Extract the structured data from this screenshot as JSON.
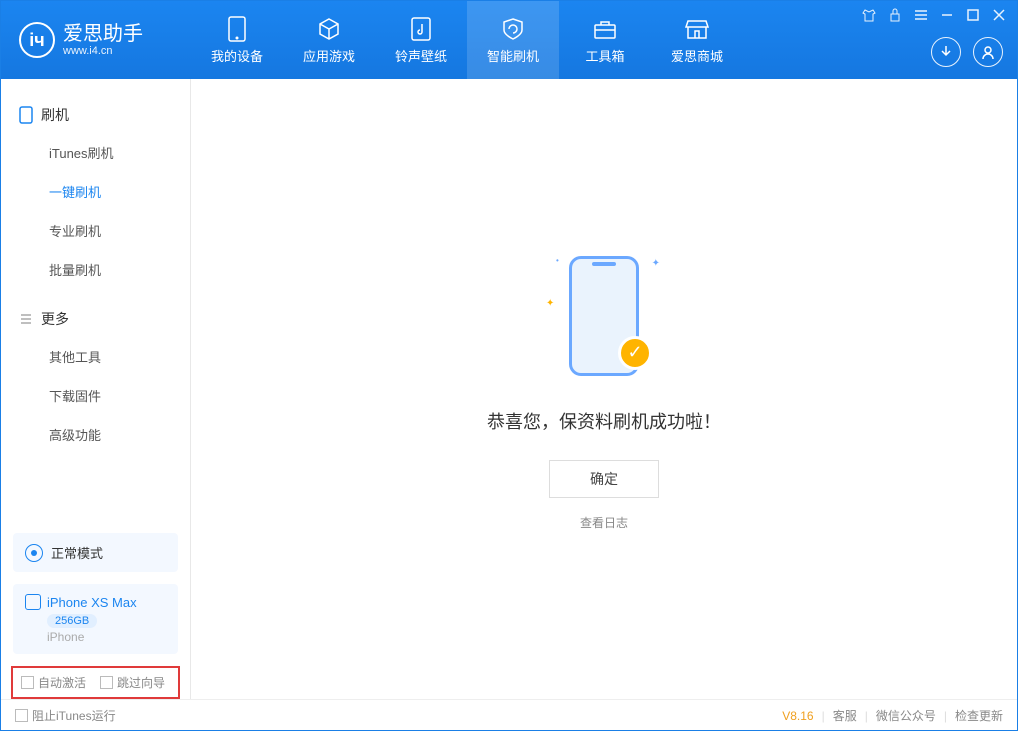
{
  "app": {
    "name": "爱思助手",
    "url": "www.i4.cn"
  },
  "nav": [
    {
      "label": "我的设备"
    },
    {
      "label": "应用游戏"
    },
    {
      "label": "铃声壁纸"
    },
    {
      "label": "智能刷机"
    },
    {
      "label": "工具箱"
    },
    {
      "label": "爱思商城"
    }
  ],
  "sidebar": {
    "group1_title": "刷机",
    "items1": [
      {
        "label": "iTunes刷机"
      },
      {
        "label": "一键刷机"
      },
      {
        "label": "专业刷机"
      },
      {
        "label": "批量刷机"
      }
    ],
    "group2_title": "更多",
    "items2": [
      {
        "label": "其他工具"
      },
      {
        "label": "下载固件"
      },
      {
        "label": "高级功能"
      }
    ]
  },
  "mode": {
    "label": "正常模式"
  },
  "device": {
    "name": "iPhone XS Max",
    "storage": "256GB",
    "type": "iPhone"
  },
  "options": {
    "auto_activate": "自动激活",
    "skip_guide": "跳过向导"
  },
  "main": {
    "success_msg": "恭喜您，保资料刷机成功啦！",
    "confirm": "确定",
    "view_log": "查看日志"
  },
  "footer": {
    "block_itunes": "阻止iTunes运行",
    "version": "V8.16",
    "support": "客服",
    "wechat": "微信公众号",
    "update": "检查更新"
  }
}
